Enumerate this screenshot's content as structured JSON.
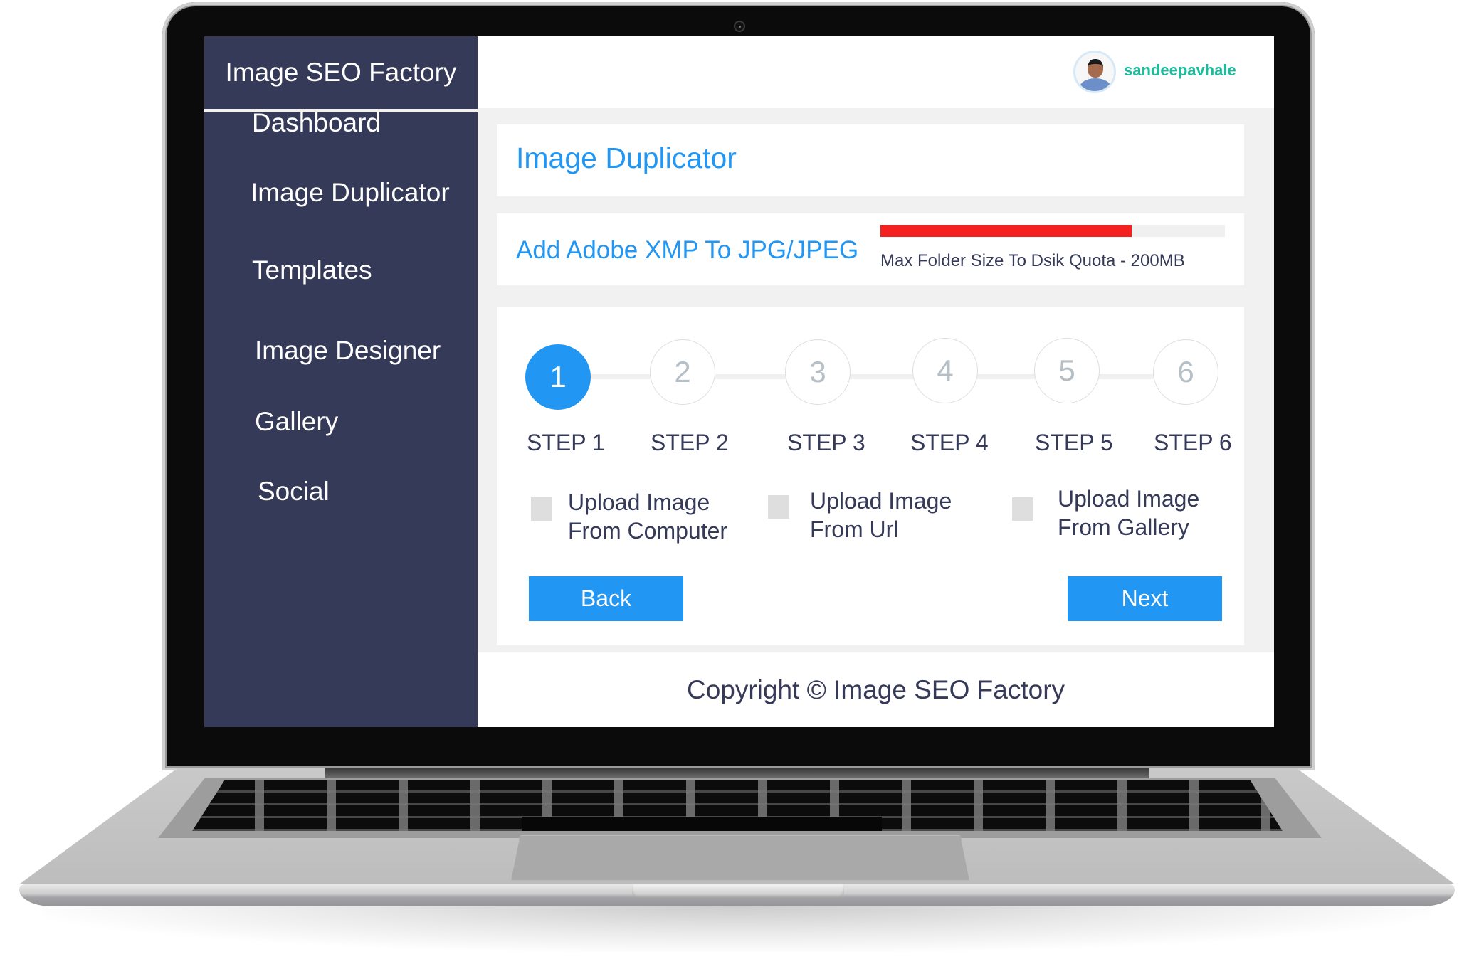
{
  "app": {
    "brand": "Image SEO Factory"
  },
  "sidebar": {
    "items": [
      {
        "label": "Dashboard"
      },
      {
        "label": "Image Duplicator"
      },
      {
        "label": "Templates"
      },
      {
        "label": "Image Designer"
      },
      {
        "label": "Gallery"
      },
      {
        "label": "Social"
      }
    ]
  },
  "header": {
    "username": "sandeepavhale",
    "avatar_icon": "user-avatar-photo"
  },
  "main": {
    "page_title": "Image Duplicator",
    "subtitle": "Add Adobe XMP To JPG/JPEG",
    "quota": {
      "label": "Max Folder Size To Dsik Quota - 200MB",
      "used_fraction": 0.73,
      "bar_color": "#f42121"
    },
    "stepper": {
      "current_step": 1,
      "steps": [
        {
          "number": "1",
          "label": "STEP 1"
        },
        {
          "number": "2",
          "label": "STEP 2"
        },
        {
          "number": "3",
          "label": "STEP 3"
        },
        {
          "number": "4",
          "label": "STEP 4"
        },
        {
          "number": "5",
          "label": "STEP 5"
        },
        {
          "number": "6",
          "label": "STEP 6"
        }
      ]
    },
    "options": [
      {
        "line1": "Upload Image",
        "line2": "From Computer",
        "checked": false
      },
      {
        "line1": "Upload Image",
        "line2": "From Url",
        "checked": false
      },
      {
        "line1": "Upload Image",
        "line2": "From Gallery",
        "checked": false
      }
    ],
    "buttons": {
      "back": "Back",
      "next": "Next"
    }
  },
  "footer": {
    "copyright": "Copyright © Image SEO Factory"
  },
  "colors": {
    "sidebar_bg": "#363a59",
    "accent": "#2196f3",
    "username": "#1abc9c",
    "quota_bar": "#f42121"
  }
}
